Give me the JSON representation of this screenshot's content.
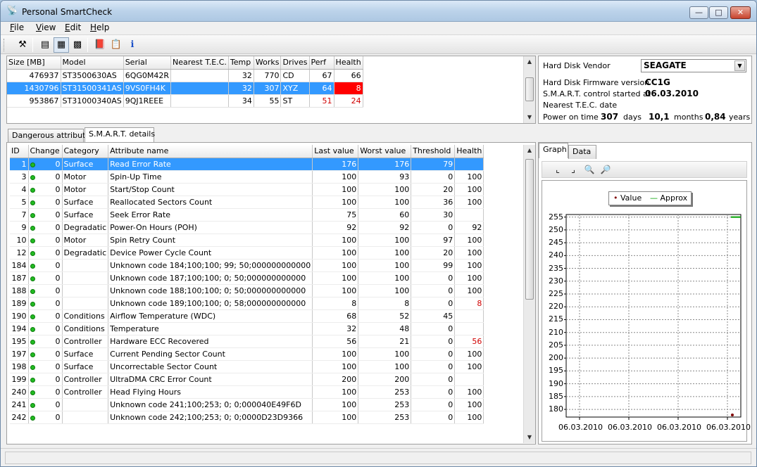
{
  "window": {
    "title": "Personal SmartCheck",
    "app_icon": "satellite-dish-icon"
  },
  "menu": [
    {
      "key": "F",
      "rest": "ile"
    },
    {
      "key": "V",
      "rest": "iew"
    },
    {
      "key": "E",
      "rest": "dit"
    },
    {
      "key": "H",
      "rest": "elp"
    }
  ],
  "disks": {
    "headers": [
      "Size [MB]",
      "Model",
      "Serial",
      "Nearest T.E.C.",
      "Temp",
      "Works",
      "Drives",
      "Perf",
      "Health"
    ],
    "rows": [
      {
        "size": "476937",
        "model": "ST3500630AS",
        "serial": "6QG0M42R",
        "tec": "",
        "temp": "32",
        "works": "770",
        "drives": "CD",
        "perf": "67",
        "health": "66"
      },
      {
        "size": "1430796",
        "model": "ST31500341AS",
        "serial": "9VS0FH4K",
        "tec": "",
        "temp": "32",
        "works": "307",
        "drives": "XYZ",
        "perf": "64",
        "health": "8"
      },
      {
        "size": "953867",
        "model": "ST31000340AS",
        "serial": "9QJ1REEE",
        "tec": "",
        "temp": "34",
        "works": "55",
        "drives": "ST",
        "perf": "51",
        "health": "24"
      }
    ]
  },
  "info": {
    "vendor_label": "Hard Disk Vendor",
    "vendor_value": "SEAGATE",
    "firmware_label": "Hard Disk Firmware version",
    "firmware_value": "CC1G",
    "smart_label": "S.M.A.R.T. control started at",
    "smart_value": "06.03.2010",
    "tec_label": "Nearest T.E.C. date",
    "power_label": "Power on time",
    "power_days": "307",
    "days_label": "days",
    "power_months": "10,1",
    "months_label": "months",
    "power_years": "0,84",
    "years_label": "years"
  },
  "tabs": {
    "dangerous": "Dangerous attributes",
    "smart": "S.M.A.R.T. details"
  },
  "attributes": {
    "headers": [
      "ID",
      "Change",
      "Category",
      "Attribute name",
      "Last value",
      "Worst value",
      "Threshold",
      "Health"
    ],
    "rows": [
      {
        "id": "1",
        "change": "0",
        "category": "Surface",
        "name": "Read Error Rate",
        "last": "176",
        "worst": "176",
        "threshold": "79",
        "health": ""
      },
      {
        "id": "3",
        "change": "0",
        "category": "Motor",
        "name": "Spin-Up Time",
        "last": "100",
        "worst": "93",
        "threshold": "0",
        "health": "100"
      },
      {
        "id": "4",
        "change": "0",
        "category": "Motor",
        "name": "Start/Stop Count",
        "last": "100",
        "worst": "100",
        "threshold": "20",
        "health": "100"
      },
      {
        "id": "5",
        "change": "0",
        "category": "Surface",
        "name": "Reallocated Sectors Count",
        "last": "100",
        "worst": "100",
        "threshold": "36",
        "health": "100"
      },
      {
        "id": "7",
        "change": "0",
        "category": "Surface",
        "name": "Seek Error Rate",
        "last": "75",
        "worst": "60",
        "threshold": "30",
        "health": ""
      },
      {
        "id": "9",
        "change": "0",
        "category": "Degradatic",
        "name": "Power-On Hours (POH)",
        "last": "92",
        "worst": "92",
        "threshold": "0",
        "health": "92"
      },
      {
        "id": "10",
        "change": "0",
        "category": "Motor",
        "name": "Spin Retry Count",
        "last": "100",
        "worst": "100",
        "threshold": "97",
        "health": "100"
      },
      {
        "id": "12",
        "change": "0",
        "category": "Degradatic",
        "name": "Device Power Cycle Count",
        "last": "100",
        "worst": "100",
        "threshold": "20",
        "health": "100"
      },
      {
        "id": "184",
        "change": "0",
        "category": "",
        "name": "Unknown code 184;100;100; 99; 50;000000000000",
        "last": "100",
        "worst": "100",
        "threshold": "99",
        "health": "100"
      },
      {
        "id": "187",
        "change": "0",
        "category": "",
        "name": "Unknown code 187;100;100;  0; 50;000000000000",
        "last": "100",
        "worst": "100",
        "threshold": "0",
        "health": "100"
      },
      {
        "id": "188",
        "change": "0",
        "category": "",
        "name": "Unknown code 188;100;100;  0; 50;000000000000",
        "last": "100",
        "worst": "100",
        "threshold": "0",
        "health": "100"
      },
      {
        "id": "189",
        "change": "0",
        "category": "",
        "name": "Unknown code 189;100;100;  0; 58;000000000000",
        "last": "8",
        "worst": "8",
        "threshold": "0",
        "health": "8"
      },
      {
        "id": "190",
        "change": "0",
        "category": "Conditions",
        "name": "Airflow Temperature (WDC)",
        "last": "68",
        "worst": "52",
        "threshold": "45",
        "health": ""
      },
      {
        "id": "194",
        "change": "0",
        "category": "Conditions",
        "name": "Temperature",
        "last": "32",
        "worst": "48",
        "threshold": "0",
        "health": ""
      },
      {
        "id": "195",
        "change": "0",
        "category": "Controller",
        "name": "Hardware ECC Recovered",
        "last": "56",
        "worst": "21",
        "threshold": "0",
        "health": "56"
      },
      {
        "id": "197",
        "change": "0",
        "category": "Surface",
        "name": "Current Pending Sector Count",
        "last": "100",
        "worst": "100",
        "threshold": "0",
        "health": "100"
      },
      {
        "id": "198",
        "change": "0",
        "category": "Surface",
        "name": "Uncorrectable Sector Count",
        "last": "100",
        "worst": "100",
        "threshold": "0",
        "health": "100"
      },
      {
        "id": "199",
        "change": "0",
        "category": "Controller",
        "name": "UltraDMA CRC Error Count",
        "last": "200",
        "worst": "200",
        "threshold": "0",
        "health": ""
      },
      {
        "id": "240",
        "change": "0",
        "category": "Controller",
        "name": "Head Flying Hours",
        "last": "100",
        "worst": "253",
        "threshold": "0",
        "health": "100"
      },
      {
        "id": "241",
        "change": "0",
        "category": "",
        "name": "Unknown code 241;100;253;  0;  0;000040E49F6D",
        "last": "100",
        "worst": "253",
        "threshold": "0",
        "health": "100"
      },
      {
        "id": "242",
        "change": "0",
        "category": "",
        "name": "Unknown code 242;100;253;  0;  0;0000D23D9366",
        "last": "100",
        "worst": "253",
        "threshold": "0",
        "health": "100"
      }
    ]
  },
  "graph": {
    "tab_graph": "Graph",
    "tab_data": "Data",
    "legend_value": "Value",
    "legend_approx": "Approx",
    "y_ticks": [
      "255",
      "250",
      "245",
      "240",
      "235",
      "230",
      "225",
      "220",
      "215",
      "210",
      "205",
      "200",
      "195",
      "190",
      "185",
      "180"
    ],
    "x_ticks": [
      "06.03.2010",
      "06.03.2010",
      "06.03.2010",
      "06.03.2010"
    ],
    "approx_color": "#00a000",
    "value_color": "#800000"
  },
  "chart_data": {
    "type": "line",
    "xlabel": "",
    "ylabel": "",
    "ylim": [
      177,
      256
    ],
    "x": [
      "06.03.2010",
      "06.03.2010",
      "06.03.2010",
      "06.03.2010"
    ],
    "series": [
      {
        "name": "Value",
        "values": [
          176
        ]
      },
      {
        "name": "Approx",
        "values": [
          255
        ]
      }
    ]
  },
  "status": {
    "text": ""
  }
}
